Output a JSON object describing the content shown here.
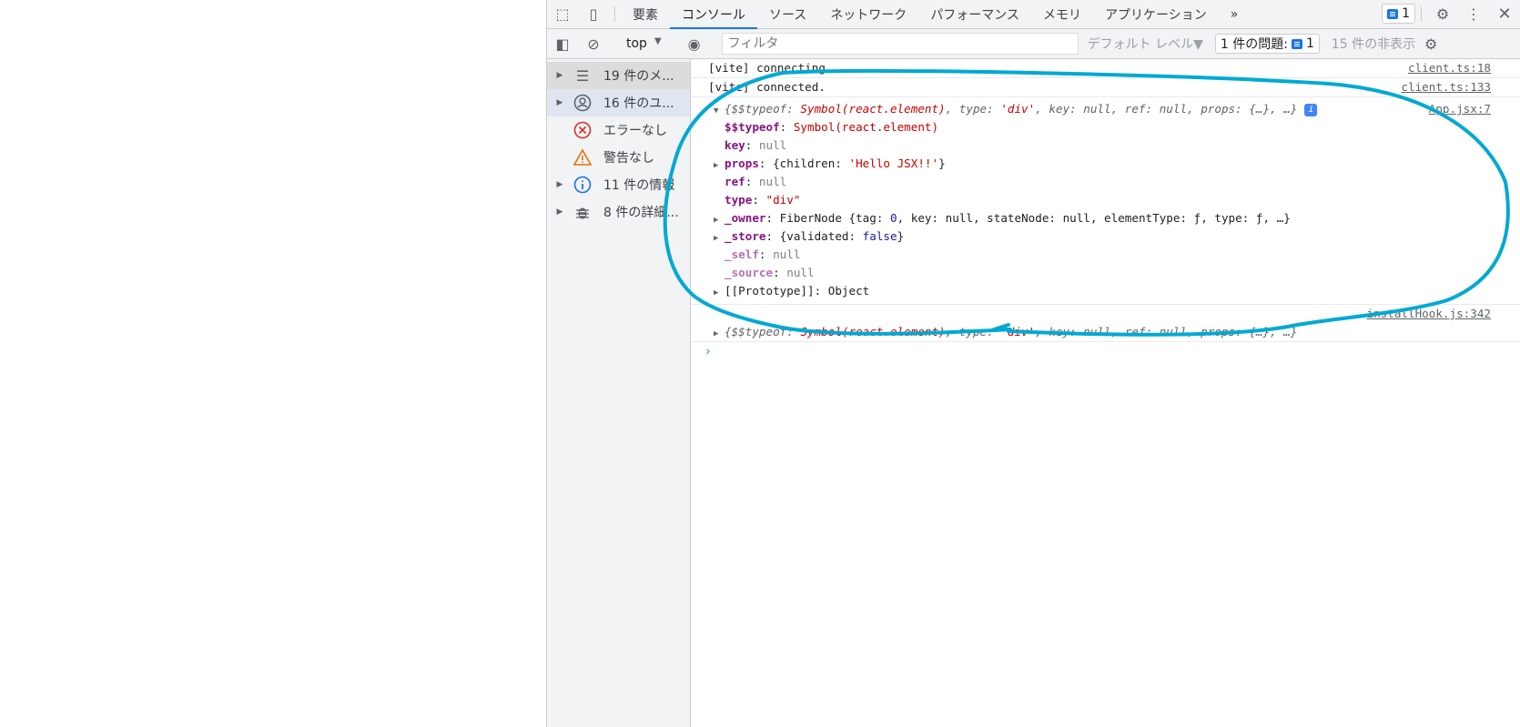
{
  "tabs": [
    "要素",
    "コンソール",
    "ソース",
    "ネットワーク",
    "パフォーマンス",
    "メモリ",
    "アプリケーション"
  ],
  "active_tab": "コンソール",
  "issues_badge_count": "1",
  "toolbar": {
    "context": "top",
    "filter_placeholder": "フィルタ",
    "level": "デフォルト レベル▼",
    "issues_label": "1 件の問題:",
    "issues_count": "1",
    "hidden": "15 件の非表示"
  },
  "sidebar": [
    {
      "label": "19 件のメ..."
    },
    {
      "label": "16 件のユ..."
    },
    {
      "label": "エラーなし"
    },
    {
      "label": "警告なし"
    },
    {
      "label": "11 件の情報"
    },
    {
      "label": "8 件の詳細..."
    }
  ],
  "console": {
    "m1": {
      "text": "[vite] connecting...",
      "src": "client.ts:18"
    },
    "m2": {
      "text": "[vite] connected.",
      "src": "client.ts:133"
    },
    "m3": {
      "src": "App.jsx:7",
      "preview": {
        "a": "{$$typeof: ",
        "b": "Symbol(react.element)",
        "c": ", type: ",
        "d": "'div'",
        "e": ", key: null, ref: null, props: {…}, …}"
      },
      "props": [
        {
          "k": "$$typeof",
          "v": "Symbol(react.element)"
        },
        {
          "k": "key",
          "v": "null"
        },
        {
          "k": "props",
          "v1": "{children: ",
          "v2": "'Hello JSX!!'",
          "v3": "}"
        },
        {
          "k": "ref",
          "v": "null"
        },
        {
          "k": "type",
          "v": "\"div\""
        },
        {
          "k": "_owner",
          "v1": "FiberNode {tag: ",
          "v2": "0",
          "v3": ", key: null, stateNode: null, elementType: ƒ, type: ƒ, …}"
        },
        {
          "k": "_store",
          "v1": "{validated: ",
          "v2": "false",
          "v3": "}"
        },
        {
          "k": "_self",
          "v": "null"
        },
        {
          "k": "_source",
          "v": "null"
        },
        {
          "k": "[[Prototype]]",
          "v": "Object"
        }
      ]
    },
    "m4": {
      "src": "installHook.js:342"
    },
    "prompt": "›",
    "sep": ": "
  },
  "ink_color": "#00a9d4"
}
